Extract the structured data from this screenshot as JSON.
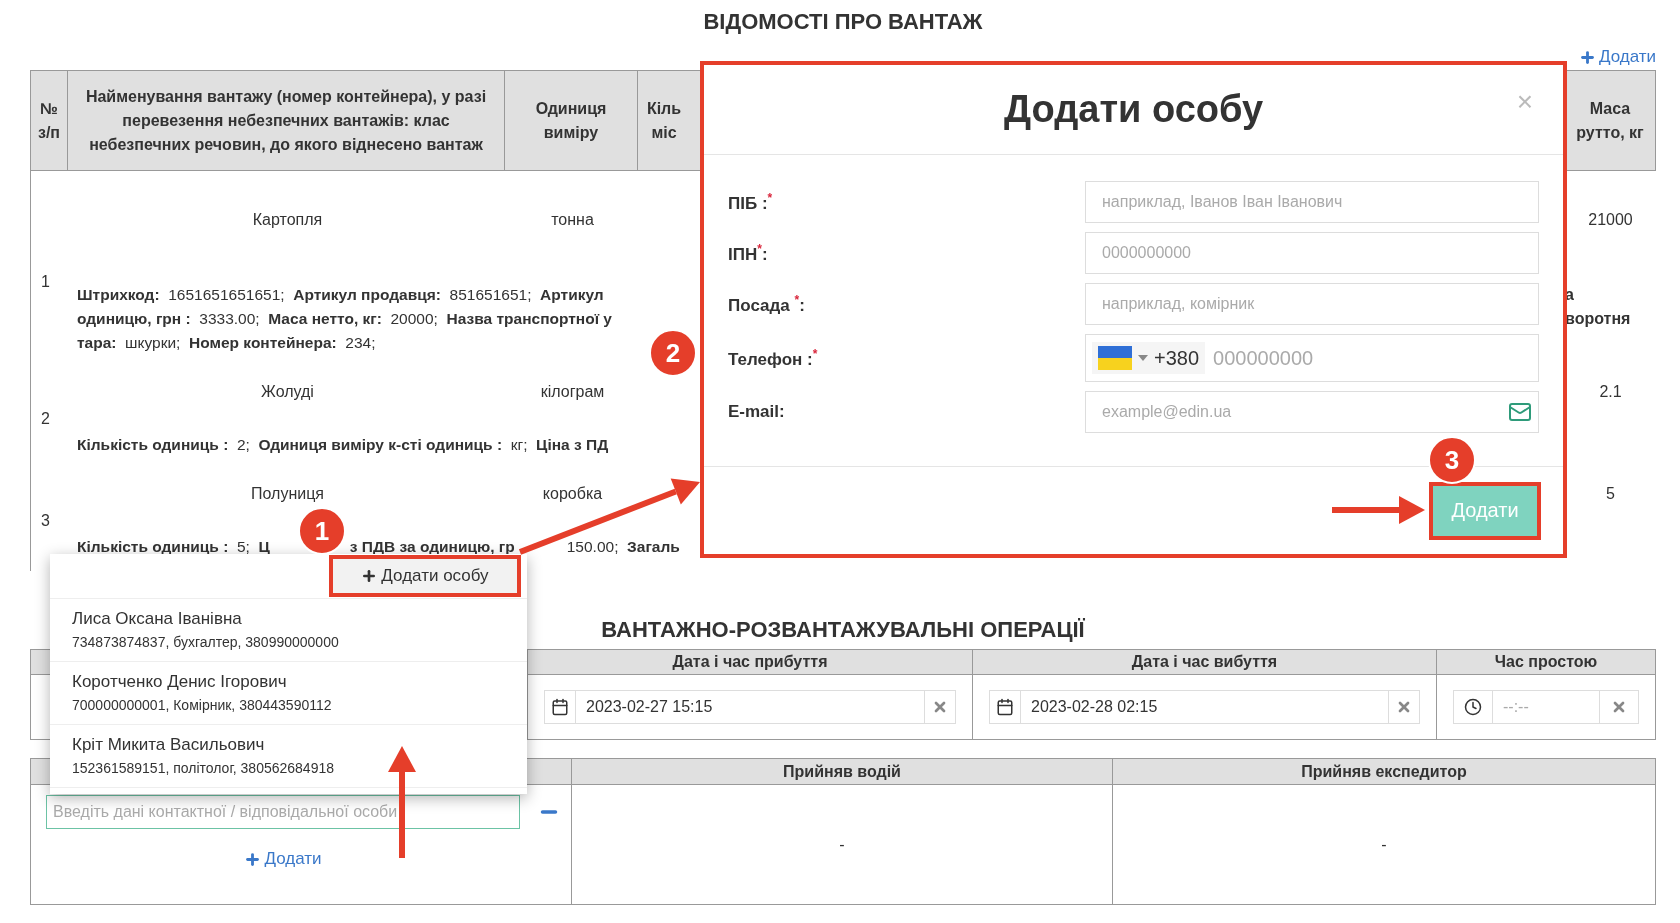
{
  "cargo": {
    "title": "ВІДОМОСТІ ПРО ВАНТАЖ",
    "add_link": "Додати",
    "columns": [
      "№ з/п",
      "Найменування вантажу (номер контейнера), у разі перевезення небезпечних вантажів: клас небезпечних речовин, до якого віднесено вантаж",
      "Одиниця виміру",
      "Кіль міс",
      "Маса рутто, кг"
    ],
    "rows": [
      {
        "number": "1",
        "name": "Картопля",
        "unit": "тонна",
        "gross": "21000",
        "details": [
          [
            "**Штрихкод:**  1651651651651;  **Артикул продавця:**  851651651;  **Артикул**"
          ],
          [
            "**одиницю, грн :**  3333.00;  **Маса нетто, кг:**  20000;  **Назва транспортної у**"
          ],
          [
            "**тара:**  шкурки;  **Номер контейнера:**  234;"
          ]
        ],
        "detail_tail": [
          "а",
          "воротня"
        ]
      },
      {
        "number": "2",
        "name": "Жолуді",
        "unit": "кілограм",
        "gross": "2.1",
        "details": [
          [
            "**Кількість одиниць :**  2;  **Одиниця виміру к-сті одиниць :**  кг;  **Ціна з ПД**"
          ]
        ]
      },
      {
        "number": "3",
        "name": "Полуниця",
        "unit": "коробка",
        "gross": "5",
        "details": [
          [
            "**Кількість одиниць :**  5;  **Ц**",
            "**з ПДВ за одиницю, гр**",
            "150.00;  **Загаль**"
          ]
        ]
      }
    ]
  },
  "operations": {
    "title": "ВАНТАЖНО-РОЗВАНТАЖУВАЛЬНІ ОПЕРАЦІЇ",
    "columns": [
      "Дата і час прибуття",
      "Дата і час вибуття",
      "Час простою"
    ],
    "arrival": "2023-02-27 15:15",
    "departure": "2023-02-28 02:15",
    "idle_placeholder": "--:--"
  },
  "acceptance": {
    "columns": [
      "Прийняв водій",
      "Прийняв експедитор"
    ],
    "contact_placeholder": "Введіть дані контактної / відповідальної особи",
    "add_link": "Додати",
    "driver": "-",
    "forwarder": "-"
  },
  "person_dropdown": {
    "add_button": "Додати особу",
    "persons": [
      {
        "name": "Лиса Оксана Іванівна",
        "details": "734873874837, бухгалтер, 380990000000"
      },
      {
        "name": "Коротченко Денис Ігорович",
        "details": "700000000001, Комірник, 380443590112"
      },
      {
        "name": "Кріт Микита Васильович",
        "details": "152361589151, політолог, 380562684918"
      }
    ]
  },
  "modal": {
    "title": "Додати особу",
    "close": "×",
    "fields": [
      {
        "kind": "text",
        "label": "ПІБ :$^{*}$",
        "placeholder": "наприклад, Іванов Іван Іванович"
      },
      {
        "kind": "text",
        "label": "ІПН$^{*}$:",
        "placeholder": "0000000000"
      },
      {
        "kind": "text",
        "label": "Посада $^{*}$:",
        "placeholder": "наприклад, комірник"
      },
      {
        "kind": "phone",
        "label": "Телефон :$^{*}$",
        "dial_code": "+380",
        "placeholder": "000000000"
      },
      {
        "kind": "email",
        "label": "E-mail:",
        "placeholder": "example@edin.ua"
      }
    ],
    "submit": "Додати"
  },
  "annotations": [
    "1",
    "2",
    "3"
  ]
}
